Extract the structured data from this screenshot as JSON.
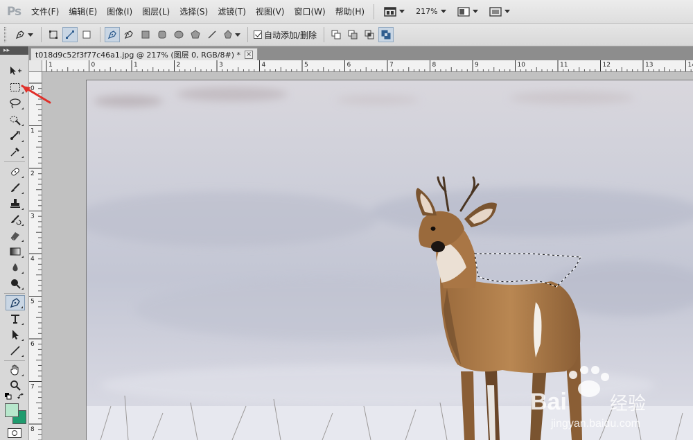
{
  "app": {
    "logo": "Ps"
  },
  "menu": [
    "文件(F)",
    "编辑(E)",
    "图像(I)",
    "图层(L)",
    "选择(S)",
    "滤镜(T)",
    "视图(V)",
    "窗口(W)",
    "帮助(H)"
  ],
  "zoom": "217%",
  "options_bar": {
    "auto_add_delete_label": "自动添加/删除",
    "auto_add_delete_checked": true,
    "active_mode": "pen"
  },
  "document": {
    "tab_title": "t018d9c52f3f77c46a1.jpg @ 217% (图层 0, RGB/8#) *",
    "close_glyph": "×"
  },
  "rulers": {
    "horizontal_labels": [
      "1",
      "0",
      "1",
      "2",
      "3",
      "4",
      "5",
      "6",
      "7",
      "8",
      "9",
      "10",
      "11",
      "12",
      "13",
      "14"
    ],
    "vertical_labels": [
      "0",
      "1",
      "2",
      "3",
      "4",
      "5",
      "6",
      "7",
      "8"
    ]
  },
  "tools": [
    {
      "name": "move-tool",
      "icon": "move-icon"
    },
    {
      "name": "marquee-tool",
      "icon": "rectangular-marquee-icon"
    },
    {
      "name": "lasso-tool",
      "icon": "lasso-icon"
    },
    {
      "name": "quick-selection-tool",
      "icon": "quick-selection-icon"
    },
    {
      "name": "crop-tool",
      "icon": "crop-icon"
    },
    {
      "name": "eyedropper-tool",
      "icon": "eyedropper-icon"
    },
    {
      "name": "healing-brush-tool",
      "icon": "bandage-icon"
    },
    {
      "name": "brush-tool",
      "icon": "brush-icon"
    },
    {
      "name": "clone-stamp-tool",
      "icon": "stamp-icon"
    },
    {
      "name": "history-brush-tool",
      "icon": "history-brush-icon"
    },
    {
      "name": "eraser-tool",
      "icon": "eraser-icon"
    },
    {
      "name": "gradient-tool",
      "icon": "gradient-icon"
    },
    {
      "name": "blur-tool",
      "icon": "droplet-icon"
    },
    {
      "name": "dodge-tool",
      "icon": "dodge-icon"
    },
    {
      "name": "pen-tool",
      "icon": "pen-icon",
      "active": true
    },
    {
      "name": "type-tool",
      "icon": "type-icon"
    },
    {
      "name": "path-selection-tool",
      "icon": "arrow-icon"
    },
    {
      "name": "line-tool",
      "icon": "line-icon"
    },
    {
      "name": "hand-tool",
      "icon": "hand-icon"
    },
    {
      "name": "zoom-tool",
      "icon": "magnifier-icon"
    }
  ],
  "colors": {
    "foreground": "#b7e7cc",
    "background": "#1f9b6e",
    "pen_accent": "#3b6ea8",
    "annotation_arrow": "#e0302a"
  },
  "watermark": {
    "brand": "Bai",
    "brand2": "经验",
    "url": "jingyan.baidu.com"
  }
}
